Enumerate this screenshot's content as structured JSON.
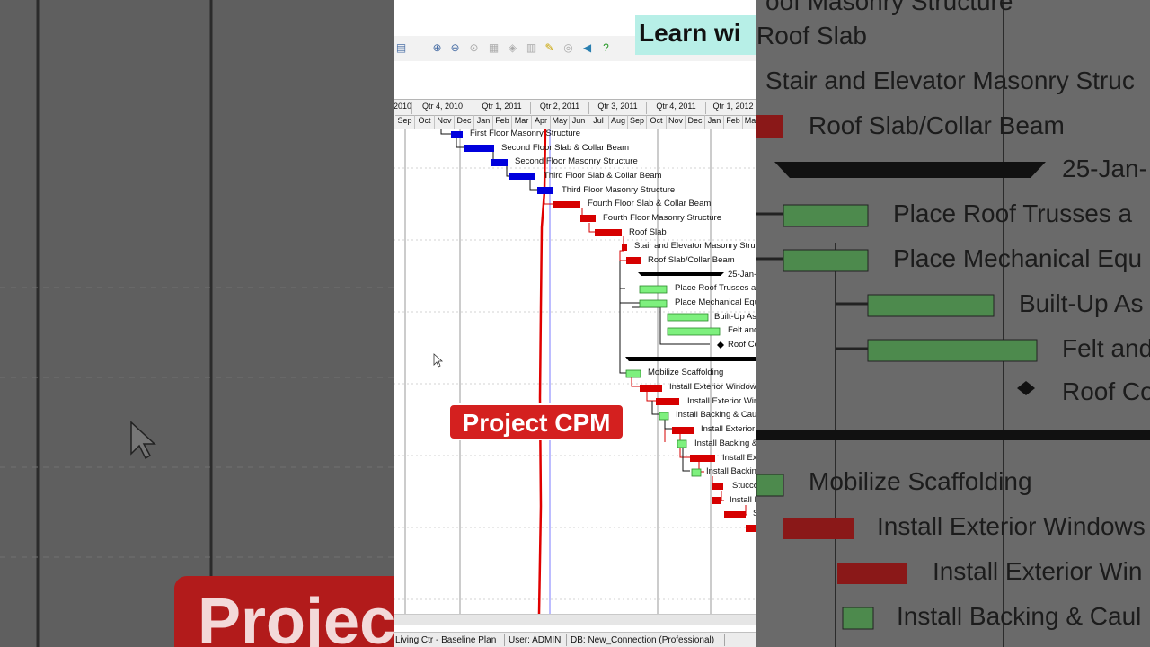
{
  "banner": {
    "text": "Learn wi"
  },
  "badge": {
    "text": "Project CPM"
  },
  "left_badge": {
    "text": "Projec"
  },
  "timescale": {
    "quarters": [
      "2010",
      "Qtr 4, 2010",
      "Qtr 1, 2011",
      "Qtr 2, 2011",
      "Qtr 3, 2011",
      "Qtr 4, 2011",
      "Qtr 1, 2012"
    ],
    "months": [
      "Sep",
      "Oct",
      "Nov",
      "Dec",
      "Jan",
      "Feb",
      "Mar",
      "Apr",
      "May",
      "Jun",
      "Jul",
      "Aug",
      "Sep",
      "Oct",
      "Nov",
      "Dec",
      "Jan",
      "Feb",
      "Ma"
    ]
  },
  "tasks": [
    "First Floor Masonry Structure",
    "Second Floor Slab & Collar Beam",
    "Second Floor Masonry Structure",
    "Third Floor Slab & Collar Beam",
    "Third Floor Masonry Structure",
    "Fourth Floor Slab & Collar Beam",
    "Fourth Floor Masonry Structure",
    "Roof Slab",
    "Stair and Elevator Masonry Struc",
    "Roof Slab/Collar Beam",
    "25-Jan-",
    "Place Roof Trusses a",
    "Place Mechanical Equ",
    "Built-Up As",
    "Felt and",
    "Roof Co",
    "Mobilize Scaffolding",
    "Install Exterior Windows",
    "Install Exterior Win",
    "Install Backing & Caul",
    "Install Exterior",
    "Install Backing &",
    "Install Ex",
    "Install Backin",
    "Stucco",
    "Install B",
    "S"
  ],
  "right_zoom": [
    "oof Masonry Structure",
    "Roof Slab",
    "Stair and Elevator Masonry Struc",
    "Roof Slab/Collar Beam",
    "25-Jan-",
    "Place Roof Trusses a",
    "Place Mechanical Equ",
    "Built-Up As",
    "Felt and",
    "Roof Co",
    "Mobilize Scaffolding",
    "Install Exterior Windows",
    "Install Exterior Win",
    "Install Backing & Caul"
  ],
  "status": {
    "project": "Living Ctr - Baseline Plan",
    "user": "User: ADMIN",
    "db": "DB: New_Connection (Professional)"
  },
  "colors": {
    "critical": "#d60000",
    "normal": "#7ef07e",
    "completed": "#0000dd",
    "summary": "#000000",
    "data_date": "#e00000"
  },
  "icons": [
    "layout-icon",
    "zoom-in-icon",
    "zoom-out-icon",
    "zoom-fit-icon",
    "grid-icon",
    "diamond-icon",
    "columns-icon",
    "note-icon",
    "filter-icon",
    "flag-icon",
    "help-icon"
  ]
}
